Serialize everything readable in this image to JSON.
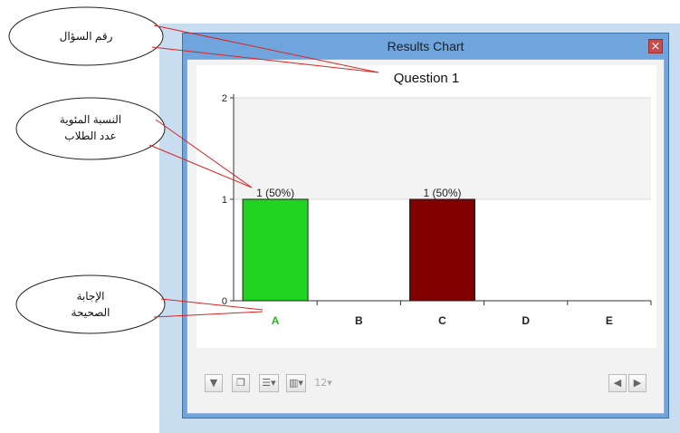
{
  "window": {
    "title": "Results Chart",
    "close_glyph": "×"
  },
  "callouts": {
    "question_number": "رقم السؤال",
    "percentage_line1": "النسبة المئوية",
    "percentage_line2": "عدد الطلاب",
    "correct_line1": "الإجابة",
    "correct_line2": "الصحيحة"
  },
  "chart_data": {
    "type": "bar",
    "title": "Question 1",
    "categories": [
      "A",
      "B",
      "C",
      "D",
      "E"
    ],
    "values": [
      1,
      0,
      1,
      0,
      0
    ],
    "bar_labels": [
      "1 (50%)",
      "",
      "1 (50%)",
      "",
      ""
    ],
    "bar_colors": [
      "#22d422",
      null,
      "#800000",
      null,
      null
    ],
    "category_label_colors": [
      "#22bb22",
      "#222222",
      "#222222",
      "#222222",
      "#222222"
    ],
    "y_ticks": [
      "0",
      "1",
      "2"
    ],
    "ylim": [
      0,
      2
    ],
    "xlabel": "",
    "ylabel": "",
    "correct_answer": "A"
  },
  "toolbar": {
    "left_buttons": [
      {
        "name": "filter-icon",
        "glyph": "▼"
      },
      {
        "name": "windows-icon",
        "glyph": "❐"
      },
      {
        "name": "sort-options-icon",
        "glyph": "☰▾"
      },
      {
        "name": "chart-type-icon",
        "glyph": "▥▾"
      },
      {
        "name": "number-format-icon",
        "glyph": "12▾"
      }
    ],
    "nav": {
      "prev_glyph": "◀",
      "next_glyph": "▶"
    }
  }
}
